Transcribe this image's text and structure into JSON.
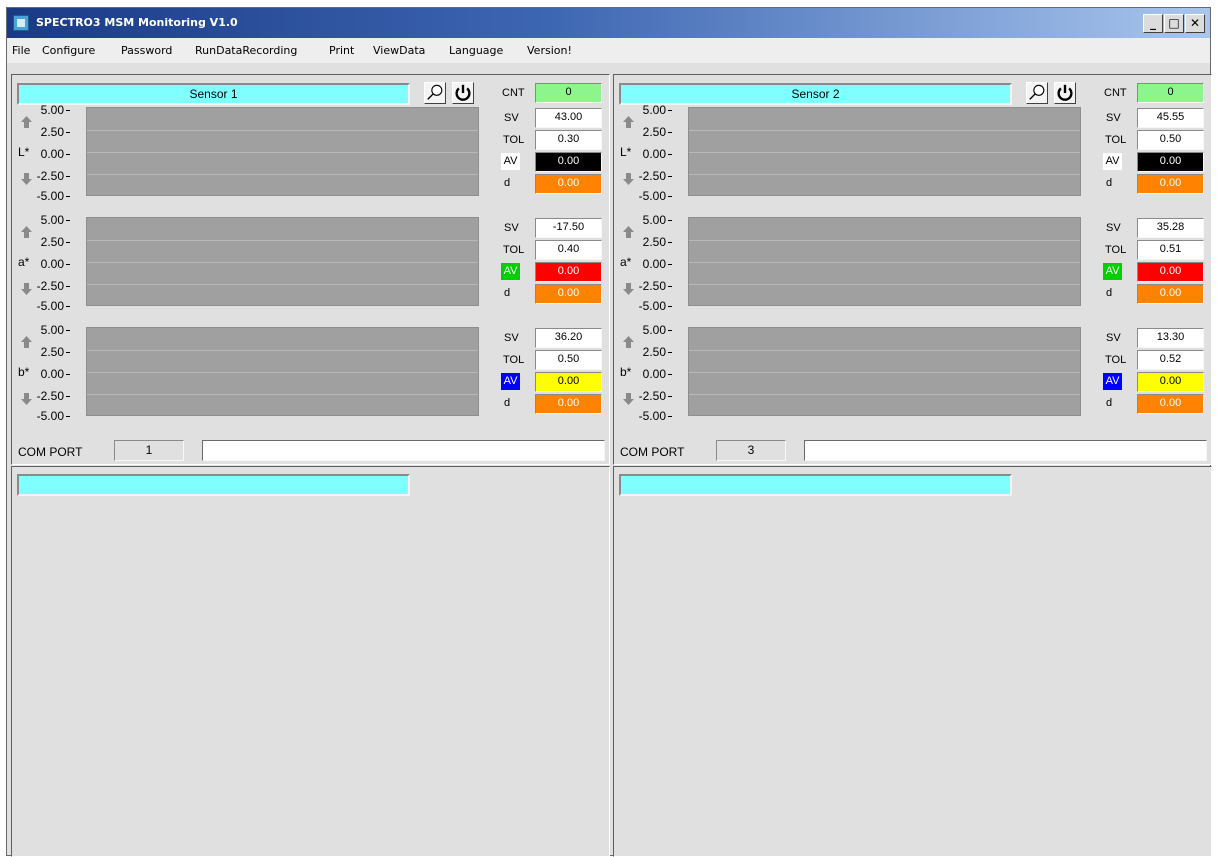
{
  "window": {
    "title": "SPECTRO3 MSM Monitoring V1.0",
    "min_label": "_",
    "max_label": "□",
    "close_label": "✕"
  },
  "menu": [
    "File",
    "Configure",
    "Password",
    "RunDataRecording",
    "Print",
    "ViewData",
    "Language",
    "Version!"
  ],
  "axis_ticks": [
    "5.00",
    "2.50",
    "0.00",
    "-2.50",
    "-5.00"
  ],
  "labels": {
    "cnt": "CNT",
    "sv": "SV",
    "tol": "TOL",
    "av": "AV",
    "d": "d",
    "com_port": "COM PORT"
  },
  "colors": {
    "name_bar": "#80ffff",
    "cnt": "#8cf58c",
    "d": "#ff8200",
    "av_a": "#ff0000",
    "av_b": "#ffff00",
    "av_L": "#000000"
  },
  "sensors": [
    {
      "name": "Sensor 1",
      "cnt": "0",
      "com_port": "1",
      "message": "",
      "channels": [
        {
          "axis": "L*",
          "sv": "43.00",
          "tol": "0.30",
          "av": "0.00",
          "d": "0.00"
        },
        {
          "axis": "a*",
          "sv": "-17.50",
          "tol": "0.40",
          "av": "0.00",
          "d": "0.00"
        },
        {
          "axis": "b*",
          "sv": "36.20",
          "tol": "0.50",
          "av": "0.00",
          "d": "0.00"
        }
      ]
    },
    {
      "name": "Sensor 2",
      "cnt": "0",
      "com_port": "3",
      "message": "",
      "channels": [
        {
          "axis": "L*",
          "sv": "45.55",
          "tol": "0.50",
          "av": "0.00",
          "d": "0.00"
        },
        {
          "axis": "a*",
          "sv": "35.28",
          "tol": "0.51",
          "av": "0.00",
          "d": "0.00"
        },
        {
          "axis": "b*",
          "sv": "13.30",
          "tol": "0.52",
          "av": "0.00",
          "d": "0.00"
        }
      ]
    }
  ],
  "lower_panels": [
    {
      "name": ""
    },
    {
      "name": ""
    }
  ]
}
